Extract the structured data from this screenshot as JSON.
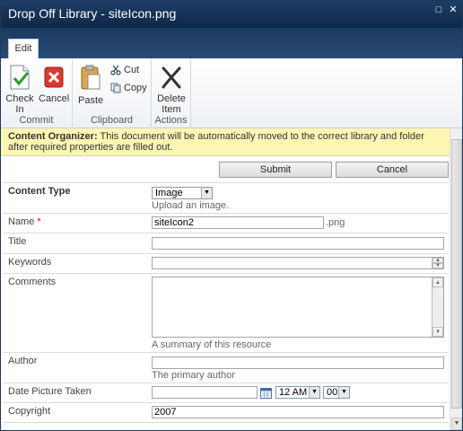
{
  "window": {
    "title": "Drop Off Library - siteIcon.png",
    "maximize_glyph": "□",
    "close_glyph": "✕"
  },
  "ribbon": {
    "tab_edit": "Edit",
    "commit": {
      "label": "Commit",
      "check_in": "Check In",
      "cancel": "Cancel"
    },
    "clipboard": {
      "label": "Clipboard",
      "paste": "Paste",
      "cut": "Cut",
      "copy": "Copy"
    },
    "actions": {
      "label": "Actions",
      "delete_item": "Delete Item"
    }
  },
  "infobar": {
    "bold": "Content Organizer:",
    "text": " This document will be automatically moved to the correct library and folder after required properties are filled out."
  },
  "buttons": {
    "submit": "Submit",
    "cancel": "Cancel"
  },
  "form": {
    "content_type": {
      "label": "Content Type",
      "value": "Image",
      "desc": "Upload an image."
    },
    "name": {
      "label": "Name",
      "required": "*",
      "value": "siteIcon2",
      "suffix": ".png"
    },
    "title": {
      "label": "Title",
      "value": ""
    },
    "keywords": {
      "label": "Keywords",
      "value": ""
    },
    "comments": {
      "label": "Comments",
      "value": "",
      "desc": "A summary of this resource"
    },
    "author": {
      "label": "Author",
      "value": "",
      "desc": "The primary author"
    },
    "date_taken": {
      "label": "Date Picture Taken",
      "date": "",
      "hour": "12 AM",
      "minute": "00"
    },
    "copyright": {
      "label": "Copyright",
      "value": "2007"
    }
  },
  "colors": {
    "titlebar": "#1e3d64",
    "infobar_bg": "#fdf6b3",
    "required": "#ee0000"
  }
}
